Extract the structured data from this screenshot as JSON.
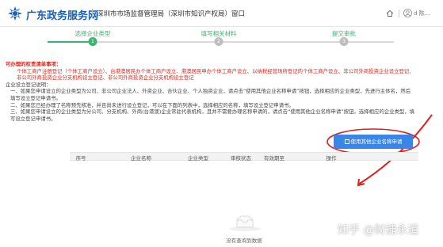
{
  "header": {
    "brand": "广东政务服务网",
    "window_title": "深圳市市场监督管理局（深圳市知识产权局）窗口",
    "user_name": "d 陈..."
  },
  "steps": [
    {
      "label": "选择企业类型",
      "index": "1"
    },
    {
      "label": "填写相关材料",
      "index": "2"
    },
    {
      "label": "提交审批",
      "index": "3"
    }
  ],
  "notice": {
    "title": "可办理的权责清单事项：",
    "red_text": "个体工商户注册登记（个体工商户设立）、台港澳居民办个体工商户设立、港澳居民申办个体工商户设立、以纳税经营场所登记的个体工商户设立、非公司外商投资企业设立登记、非公司外商投资企业分支机构设立登记、非公司外商投资企业分支机构设立登记",
    "intro": "企业设立登记说明：",
    "item1": "一、如果您申请设立的企业类型为公司、非公司企业法人、外资企业、合伙企业、个人独资企业，请点击“使用其他企业名称申请”按钮，选择相应的企业类型，先进行主体名，然后填写设立登记申请书。",
    "item2": "二、如果您已经办理了名称预先核准，并且尚未进行设立登记，可以在下面的列表中，选择相应的名称，填写设立登记申请书。",
    "item3": "三、如果您申请设立的企业类型为分公司、分支机构、外商(台港澳)企业常驻代表机构，且并不需要办理名称申请的，请点击“使用其他企业名称申请”按钮，选择相应的企业类型，填写设立登记申请书。"
  },
  "button_other": "使用其他企业名称申请",
  "table": {
    "columns": [
      "序号",
      "企业名称",
      "企业类型",
      "审核状态",
      "有效期至",
      "操作"
    ],
    "empty_text": "没有查询到数据"
  },
  "watermark": "知乎 @财捷永道",
  "colors": {
    "brand_blue": "#1a5fb4",
    "step_green": "#3cb371",
    "notice_red": "#e0251b",
    "button_blue": "#3a86e8",
    "annotation_red": "#e02020"
  },
  "icons": {
    "logo": "guangdong-logo-icon",
    "home": "home-icon",
    "user": "user-icon",
    "edit": "edit-icon",
    "empty": "empty-box-icon"
  }
}
